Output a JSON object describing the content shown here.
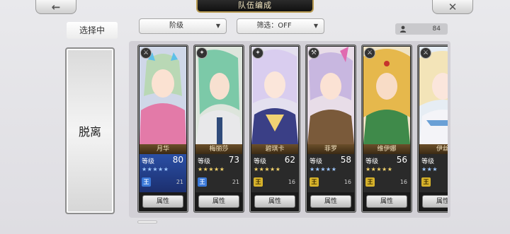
{
  "header": {
    "title": "队伍编成",
    "back_icon": "arrow-left-icon",
    "close_icon": "close-icon"
  },
  "left": {
    "selecting_label": "选择中",
    "remove_label": "脱离"
  },
  "dropdowns": {
    "rank": {
      "label": "阶级"
    },
    "filter": {
      "label": "筛选：OFF"
    }
  },
  "counter": {
    "value": "84",
    "icon": "user-icon"
  },
  "level_label": "等级",
  "attr_label": "属性",
  "cards": [
    {
      "name": "月华",
      "level": "80",
      "stars": 5,
      "star_color": "#9fc8ff",
      "cost": "21",
      "class_icon": "blue",
      "weapon": "⚔",
      "stats_style": "blue"
    },
    {
      "name": "梅丽莎",
      "level": "73",
      "stars": 5,
      "star_color": "#f3d36b",
      "cost": "21",
      "class_icon": "blue",
      "weapon": "✦",
      "stats_style": "dark"
    },
    {
      "name": "碧琪卡",
      "level": "62",
      "stars": 5,
      "star_color": "#f3d36b",
      "cost": "16",
      "class_icon": "gold",
      "weapon": "✦",
      "stats_style": "dark"
    },
    {
      "name": "菲罗",
      "level": "58",
      "stars": 5,
      "star_color": "#9fc8ff",
      "cost": "16",
      "class_icon": "gold",
      "weapon": "⚒",
      "stats_style": "dark"
    },
    {
      "name": "维伊娜",
      "level": "56",
      "stars": 5,
      "star_color": "#f3d36b",
      "cost": "16",
      "class_icon": "gold",
      "weapon": "⚔",
      "stats_style": "dark"
    },
    {
      "name": "伊丝",
      "level": "",
      "stars": 3,
      "star_color": "#9fc8ff",
      "cost": "",
      "class_icon": "gold",
      "weapon": "⚔",
      "stats_style": "dark"
    }
  ]
}
